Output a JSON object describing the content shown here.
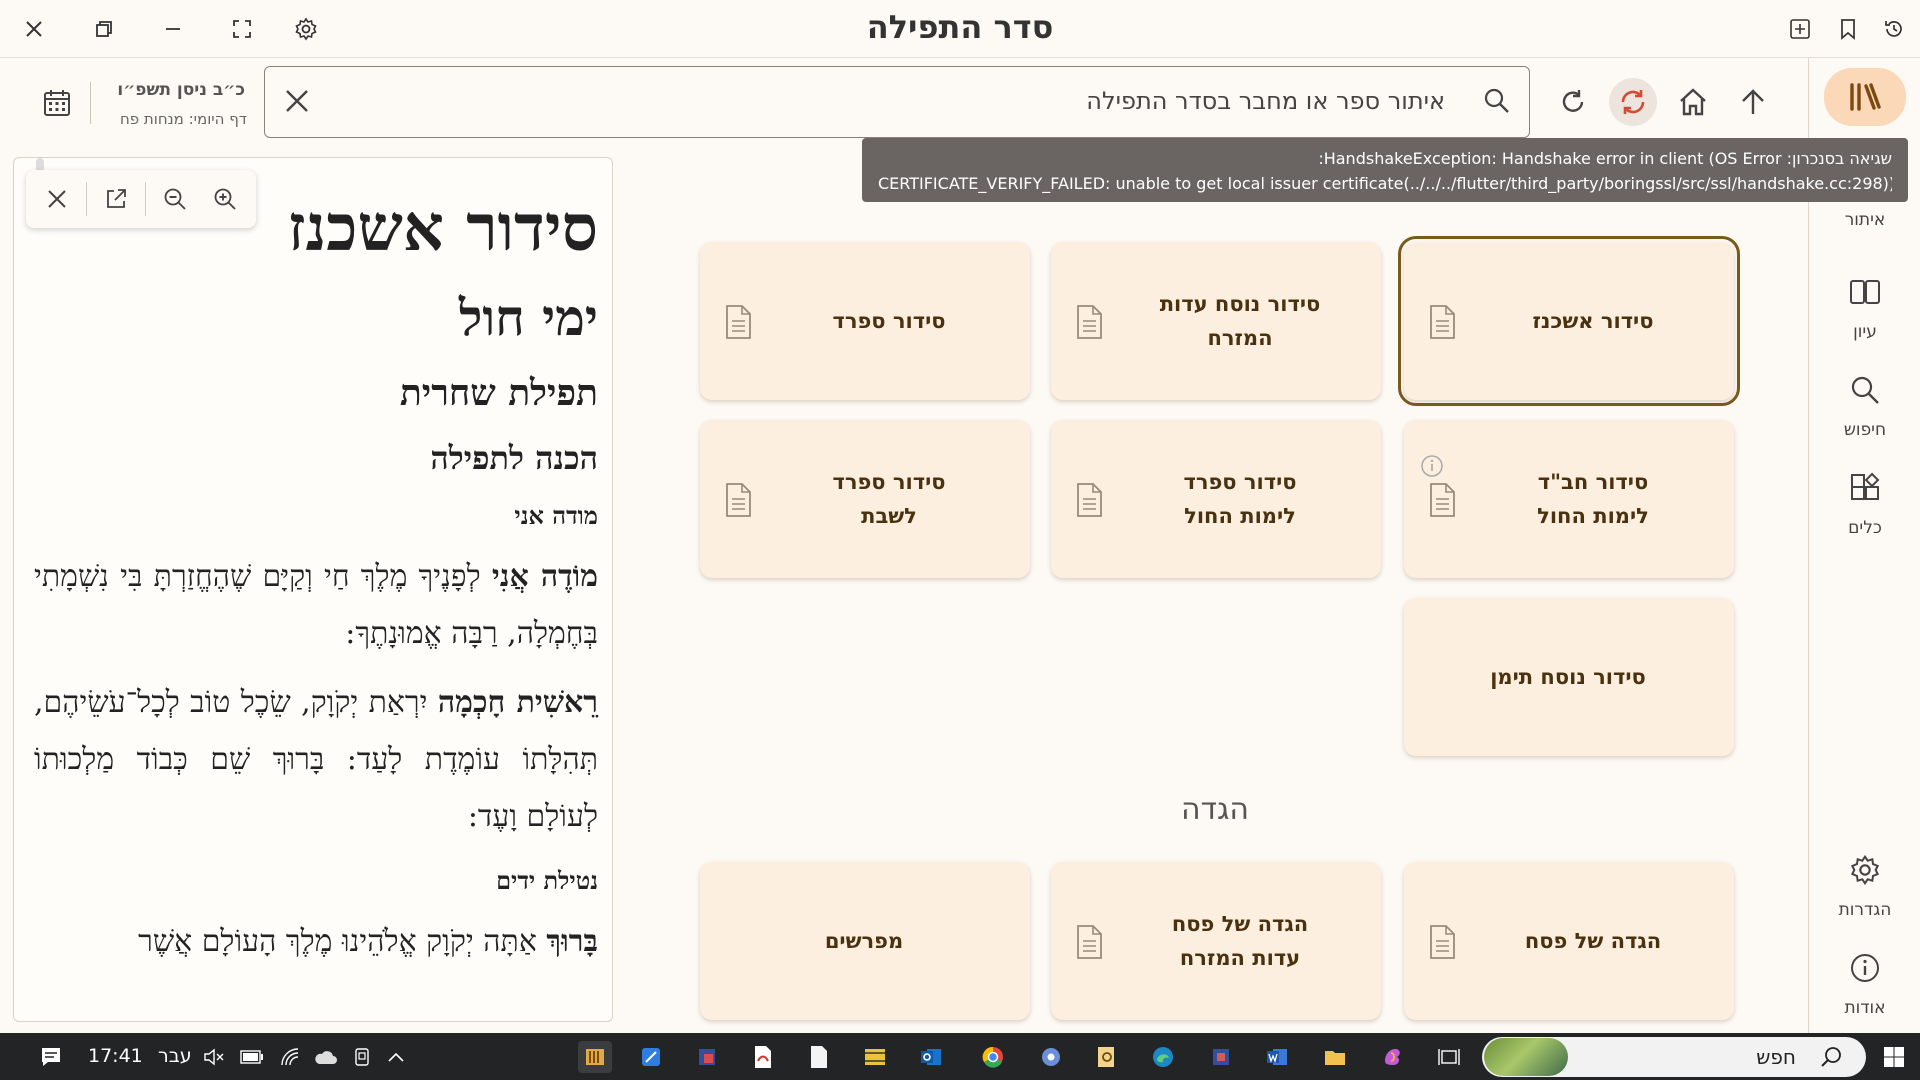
{
  "window": {
    "title": "סדר התפילה"
  },
  "toolbar": {
    "date_hebrew": "כ״ב ניסן תשפ״ו",
    "daf_yomi": "דף היומי: מנחות פח",
    "search_placeholder": "איתור ספר או מחבר בסדר התפילה"
  },
  "rail": {
    "items": [
      {
        "label": "ספריה",
        "icon": "library-icon"
      },
      {
        "label": "איתור",
        "icon": "find-icon"
      },
      {
        "label": "עיון",
        "icon": "book-open-icon"
      },
      {
        "label": "חיפוש",
        "icon": "search-icon"
      },
      {
        "label": "כלים",
        "icon": "tools-icon"
      },
      {
        "label": "הגדרות",
        "icon": "gear-icon"
      },
      {
        "label": "אודות",
        "icon": "info-icon"
      }
    ]
  },
  "tooltip": {
    "line1": "שגיאה בסנכרון: HandshakeException: Handshake error in client (OS Error:",
    "line2": "CERTIFICATE_VERIFY_FAILED: unable to get local issuer certificate(../../../flutter/third_party/boringssl/src/ssl/handshake.cc:298))"
  },
  "reader": {
    "h1": "סידור אשכנז",
    "h2": "ימי חול",
    "h3": "תפילת שחרית",
    "h4": "הכנה לתפילה",
    "h5a": "מודה אני",
    "p1_bold": "מוֹדֶה אֲנִי",
    "p1_rest": " לְפָנֶיךָ מֶלֶךְ חַי וְקַיָּם שֶׁהֶחֱזַרְתָּ בִּי נִשְׁמָתִי בְּחֶמְלָה, רַבָּה אֱמוּנָתֶךָ:",
    "p2_bold": "רֵאשִׁית חָכְמָה",
    "p2_rest": " יִרְאַת יְקֹוָק, שֵׂכֶל טוֹב לְכָל־עֹשֵׂיהֶם, תְּהִלָּתוֹ עוֹמֶדֶת לָעַד: בָּרוּךְ שֵׁם כְּבוֹד מַלְכוּתוֹ לְעוֹלָם וָעֶד:",
    "h5b": "נטילת ידים",
    "p3_bold": "בָּרוּךְ",
    "p3_rest": " אַתָּה יְקֹוָק אֱלֹהֵינוּ מֶלֶךְ הָעוֹלָם אֲשֶׁר"
  },
  "grid": {
    "row1": [
      {
        "line1": "סידור אשכנז",
        "line2": ""
      },
      {
        "line1": "סידור נוסח עדות",
        "line2": "המזרח"
      },
      {
        "line1": "סידור ספרד",
        "line2": ""
      }
    ],
    "row2": [
      {
        "line1": "סידור חב\"ד",
        "line2": "לימות החול"
      },
      {
        "line1": "סידור ספרד",
        "line2": "לימות החול"
      },
      {
        "line1": "סידור ספרד",
        "line2": "לשבת"
      }
    ],
    "row3": [
      {
        "line1": "סידור נוסח תימן",
        "line2": ""
      }
    ],
    "section_hagada": "הגדה",
    "row4": [
      {
        "line1": "הגדה של פסח",
        "line2": ""
      },
      {
        "line1": "הגדה של פסח",
        "line2": "עדות המזרח"
      },
      {
        "line1": "מפרשים",
        "line2": ""
      }
    ]
  },
  "taskbar": {
    "time": "17:41",
    "lang": "עבר",
    "search_label": "חפש"
  },
  "colors": {
    "accent": "#b8671f",
    "card_bg": "#fcefe0",
    "card_text": "#4a3210",
    "rail_active": "#fbd8b8"
  }
}
